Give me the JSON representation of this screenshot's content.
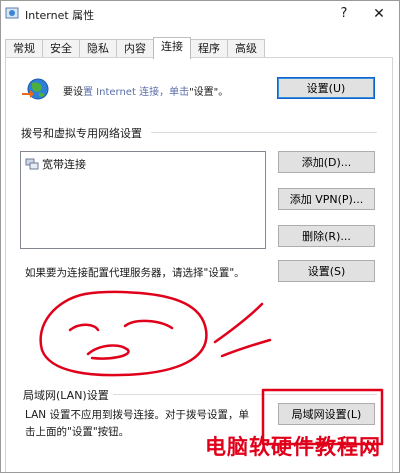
{
  "window": {
    "title": "Internet 属性",
    "help_glyph": "?",
    "close_glyph": "✕"
  },
  "tabs": [
    {
      "label": "常规"
    },
    {
      "label": "安全"
    },
    {
      "label": "隐私"
    },
    {
      "label": "内容"
    },
    {
      "label": "连接"
    },
    {
      "label": "程序"
    },
    {
      "label": "高级"
    }
  ],
  "setup": {
    "text_prefix": "要设",
    "text_blurred": "置 Internet 连接，单击",
    "text_suffix": "\"设置\"。",
    "button_label": "设置(U)"
  },
  "dialup": {
    "section_label": "拨号和虚拟专用网络设置",
    "items": [
      {
        "label": "宽带连接"
      }
    ],
    "add_button": "添加(D)...",
    "add_vpn_button": "添加 VPN(P)...",
    "remove_button": "删除(R)...",
    "proxy_text": "如果要为连接配置代理服务器，请选择\"设置\"。",
    "settings_button": "设置(S)"
  },
  "lan": {
    "section_label": "局域网(LAN)设置",
    "description": "LAN 设置不应用到拨号连接。对于拨号设置，单击上面的\"设置\"按钮。",
    "button_label": "局域网设置(L)"
  },
  "watermark": {
    "text": "电脑软硬件教程网"
  },
  "colors": {
    "annotation_red": "#e0001a",
    "default_button_border": "#0a64c8"
  }
}
